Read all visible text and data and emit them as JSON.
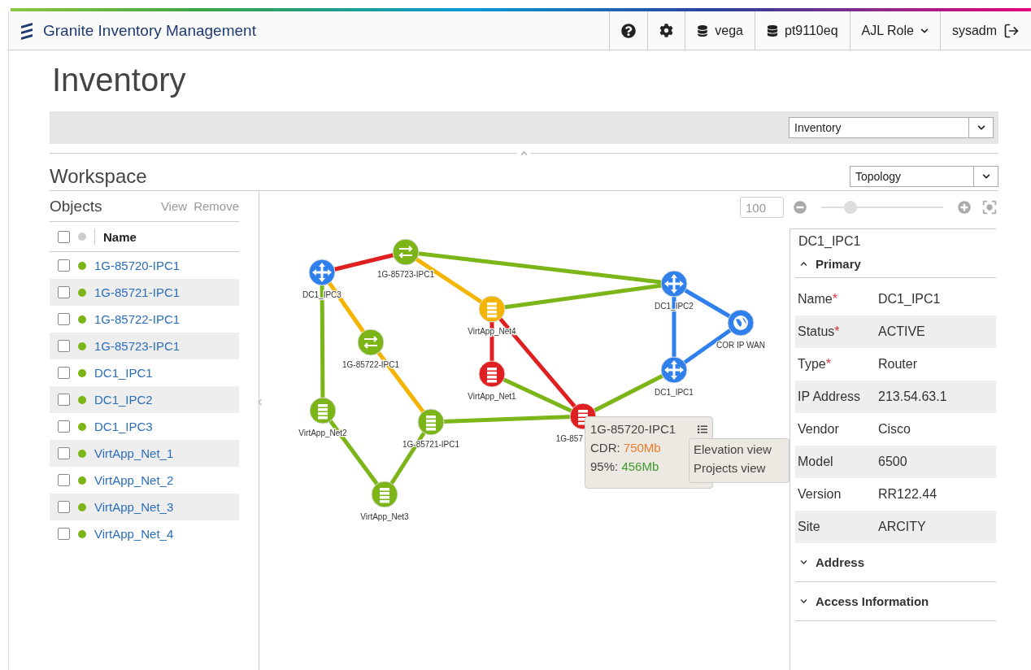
{
  "header": {
    "title": "Granite Inventory Management",
    "items": [
      {
        "kind": "help"
      },
      {
        "kind": "settings"
      },
      {
        "kind": "server",
        "label": "vega"
      },
      {
        "kind": "database",
        "label": "pt9110eq"
      },
      {
        "kind": "dropdown",
        "label": "AJL Role"
      },
      {
        "kind": "logout",
        "label": "sysadm"
      }
    ]
  },
  "page_title": "Inventory",
  "inventory_select": {
    "value": "Inventory"
  },
  "workspace": {
    "title": "Workspace",
    "view_select": {
      "value": "Topology"
    }
  },
  "objects": {
    "title": "Objects",
    "actions": [
      "View",
      "Remove"
    ],
    "column": "Name",
    "all_checked": false,
    "items": [
      {
        "name": "1G-85720-IPC1",
        "checked": false,
        "color": "#7cb518"
      },
      {
        "name": "1G-85721-IPC1",
        "checked": false,
        "color": "#7cb518"
      },
      {
        "name": "1G-85722-IPC1",
        "checked": false,
        "color": "#7cb518"
      },
      {
        "name": "1G-85723-IPC1",
        "checked": false,
        "color": "#7cb518"
      },
      {
        "name": "DC1_IPC1",
        "checked": false,
        "color": "#7cb518"
      },
      {
        "name": "DC1_IPC2",
        "checked": false,
        "color": "#7cb518"
      },
      {
        "name": "DC1_IPC3",
        "checked": false,
        "color": "#7cb518"
      },
      {
        "name": "VirtApp_Net_1",
        "checked": false,
        "color": "#7cb518"
      },
      {
        "name": "VirtApp_Net_2",
        "checked": false,
        "color": "#7cb518"
      },
      {
        "name": "VirtApp_Net_3",
        "checked": false,
        "color": "#7cb518"
      },
      {
        "name": "VirtApp_Net_4",
        "checked": false,
        "color": "#7cb518"
      }
    ]
  },
  "zoom": {
    "placeholder": "100",
    "level": 0.24
  },
  "topology": {
    "nodes": [
      {
        "label": "DC1_IPC3",
        "kind": "router",
        "color": "#2f80ed"
      },
      {
        "label": "1G-85723-IPC1",
        "kind": "switch",
        "color": "#7cb518"
      },
      {
        "label": "VirtApp_Net4",
        "kind": "server",
        "color": "#f5b400"
      },
      {
        "label": "DC1_IPC2",
        "kind": "router",
        "color": "#2f80ed"
      },
      {
        "label": "COR IP WAN",
        "kind": "cloud",
        "color": "#2f80ed"
      },
      {
        "label": "1G-85722-IPC1",
        "kind": "switch",
        "color": "#7cb518"
      },
      {
        "label": "VirtApp_Net1",
        "kind": "server",
        "color": "#e02020"
      },
      {
        "label": "DC1_IPC1",
        "kind": "router",
        "color": "#2f80ed"
      },
      {
        "label": "VirtApp_Net2",
        "kind": "server",
        "color": "#7cb518"
      },
      {
        "label": "1G-85721-IPC1",
        "kind": "server",
        "color": "#7cb518"
      },
      {
        "label": "1G-857",
        "kind": "server",
        "color": "#e02020"
      },
      {
        "label": "VirtApp_Net3",
        "kind": "server",
        "color": "#7cb518"
      }
    ],
    "links": [
      {
        "color": "#e02020"
      },
      {
        "color": "#7cb518"
      },
      {
        "color": "#f5b400"
      },
      {
        "color": "#f5b400"
      },
      {
        "color": "#7cb518"
      },
      {
        "color": "#f5b400"
      },
      {
        "color": "#7cb518"
      },
      {
        "color": "#e02020"
      },
      {
        "color": "#e02020"
      },
      {
        "color": "#7cb518"
      },
      {
        "color": "#7cb518"
      },
      {
        "color": "#7cb518"
      },
      {
        "color": "#2f80ed"
      },
      {
        "color": "#2f80ed"
      },
      {
        "color": "#2f80ed"
      },
      {
        "color": "#7cb518"
      },
      {
        "color": "#7cb518"
      }
    ]
  },
  "tooltip": {
    "title": "1G-85720-IPC1",
    "metrics": [
      {
        "label": "CDR:",
        "value": "750Mb",
        "color": "#f07b2c"
      },
      {
        "label": "95%:",
        "value": "456Mb",
        "color": "#3f9a2e"
      }
    ],
    "menu": [
      "Elevation view",
      "Projects view"
    ]
  },
  "details": {
    "title": "DC1_IPC1",
    "sections": [
      {
        "title": "Primary",
        "expanded": true,
        "fields": [
          {
            "label": "Name",
            "required_mark": "*",
            "value": "DC1_IPC1"
          },
          {
            "label": "Status",
            "required_mark": "*",
            "value": "ACTIVE"
          },
          {
            "label": "Type",
            "required_mark": "*",
            "value": "Router"
          },
          {
            "label": "IP Address",
            "value": "213.54.63.1"
          },
          {
            "label": "Vendor",
            "value": "Cisco"
          },
          {
            "label": "Model",
            "value": "6500"
          },
          {
            "label": "Version",
            "value": "RR122.44"
          },
          {
            "label": "Site",
            "value": "ARCITY"
          }
        ]
      },
      {
        "title": "Address",
        "expanded": false
      },
      {
        "title": "Access Information",
        "expanded": false
      }
    ]
  }
}
